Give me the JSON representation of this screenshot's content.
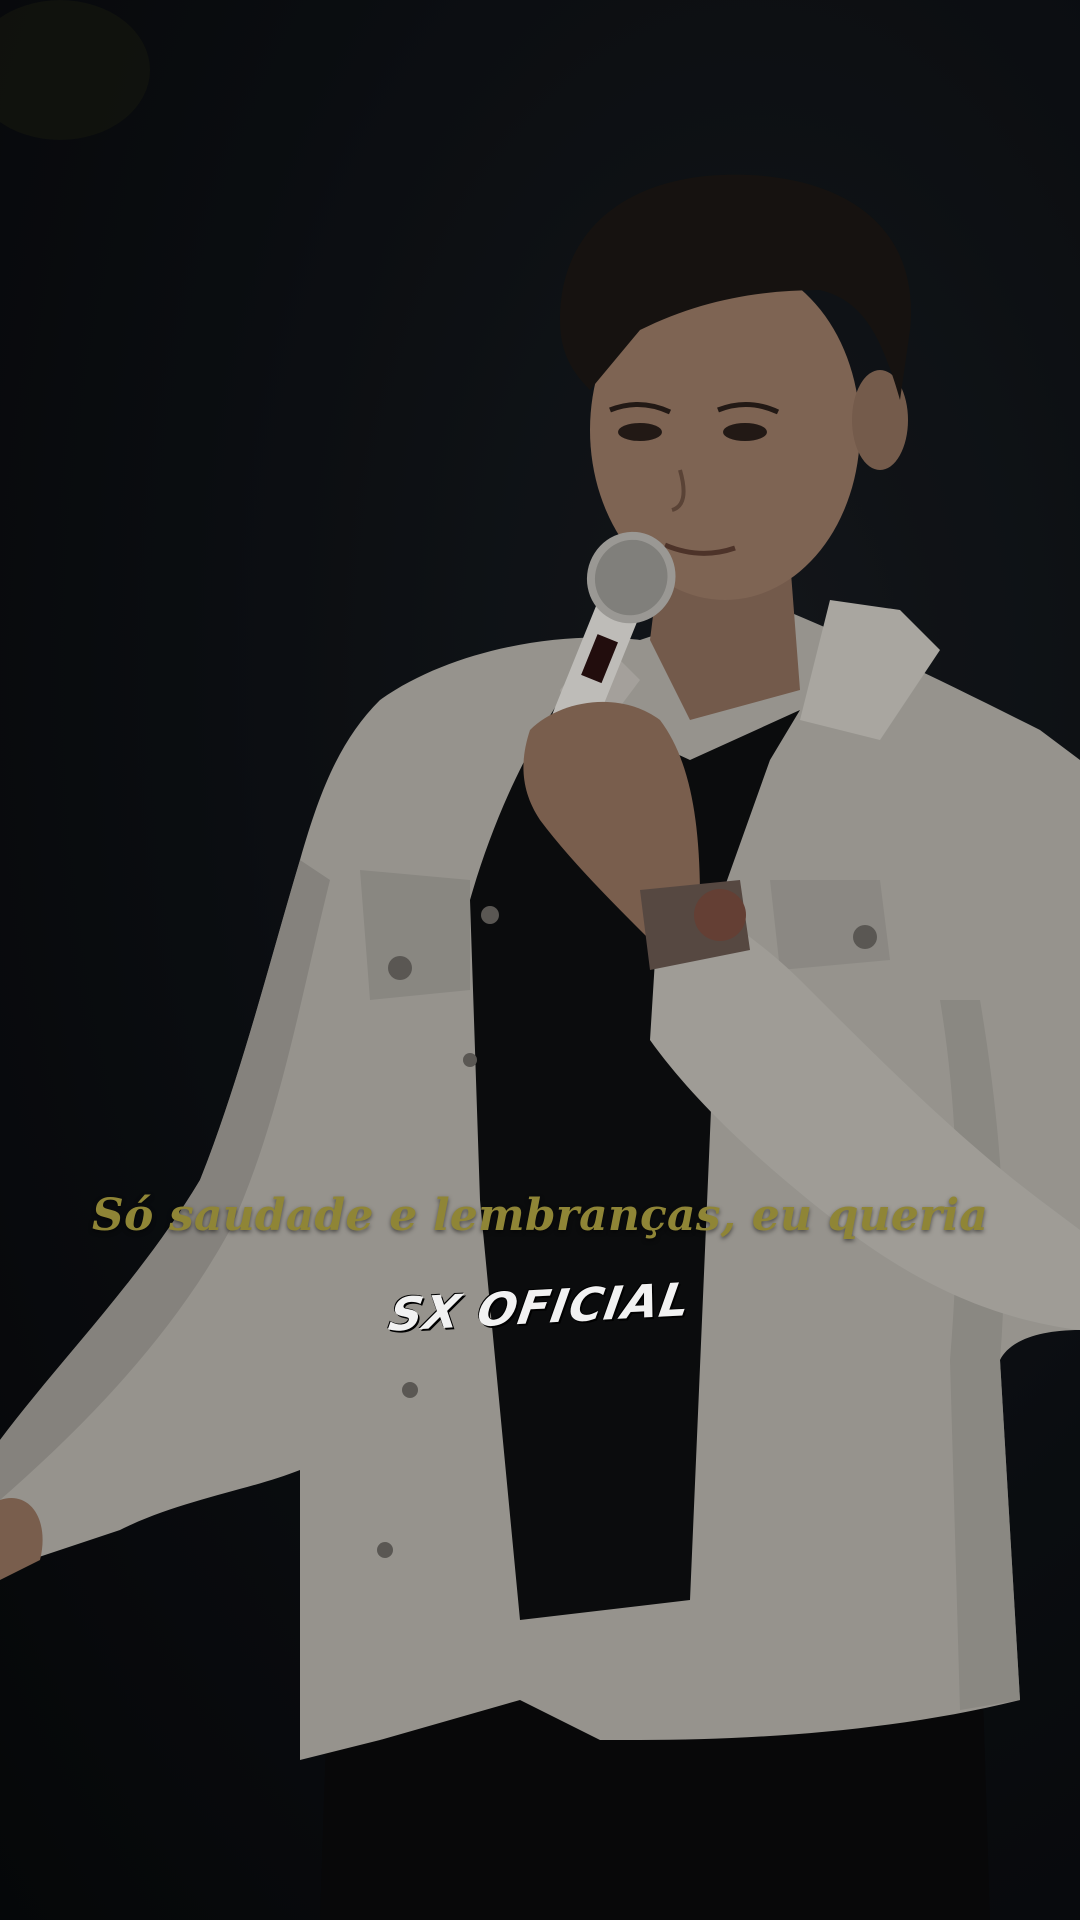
{
  "video": {
    "lyric_line": "Só saudade e lembranças, eu queria",
    "watermark": "SX OFICIAL"
  },
  "colors": {
    "background": "#0b0e12",
    "lyric": "#8f8536",
    "watermark": "#f2f2f2",
    "jacket": "#b9b6b0",
    "shirt": "#0e0f10"
  }
}
